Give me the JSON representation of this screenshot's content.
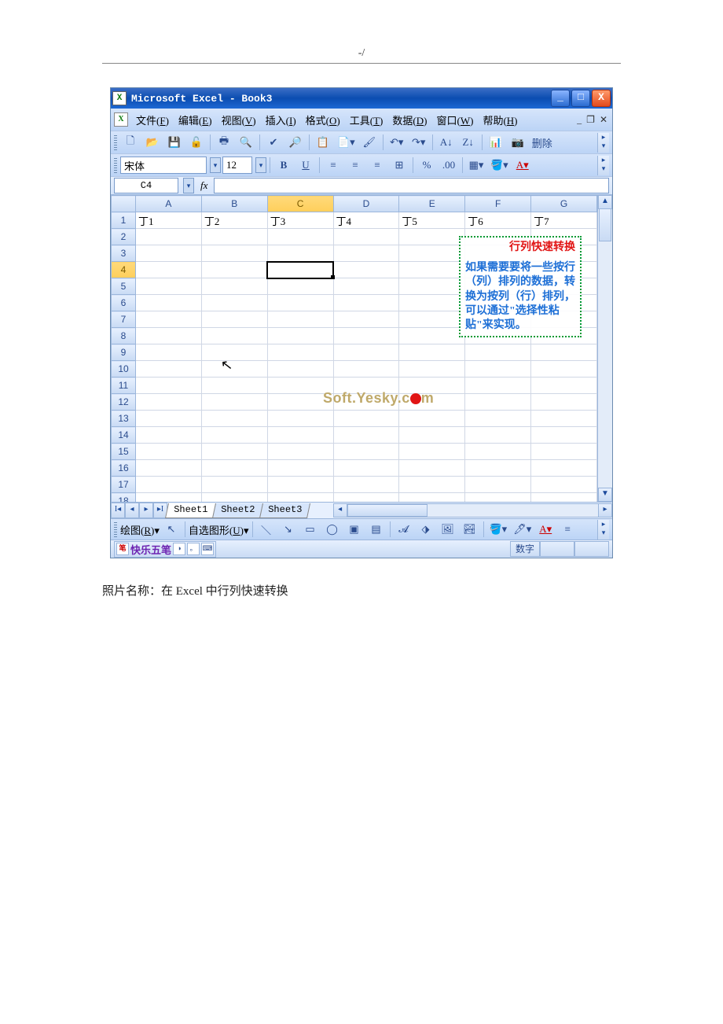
{
  "page": {
    "header_mark": "-/"
  },
  "title": {
    "text": "Microsoft Excel - Book3"
  },
  "menu": {
    "items": [
      {
        "label": "文件",
        "key": "F"
      },
      {
        "label": "编辑",
        "key": "E"
      },
      {
        "label": "视图",
        "key": "V"
      },
      {
        "label": "插入",
        "key": "I"
      },
      {
        "label": "格式",
        "key": "O"
      },
      {
        "label": "工具",
        "key": "T"
      },
      {
        "label": "数据",
        "key": "D"
      },
      {
        "label": "窗口",
        "key": "W"
      },
      {
        "label": "帮助",
        "key": "H"
      }
    ]
  },
  "font": {
    "name": "宋体",
    "size": "12"
  },
  "toolbar": {
    "delete_label": "删除"
  },
  "formula": {
    "cell_ref": "C4",
    "fx_label": "fx"
  },
  "columns": [
    "A",
    "B",
    "C",
    "D",
    "E",
    "F",
    "G"
  ],
  "rows": [
    1,
    2,
    3,
    4,
    5,
    6,
    7,
    8,
    9,
    10,
    11,
    12,
    13,
    14,
    15,
    16,
    17,
    18
  ],
  "row1": [
    "丁1",
    "丁2",
    "丁3",
    "丁4",
    "丁5",
    "丁6",
    "丁7"
  ],
  "selected": {
    "row": 4,
    "col": "C"
  },
  "callout": {
    "title": "行列快速转换",
    "body": "如果需要要将一些按行（列）排列的数据，转换为按列（行）排列，可以通过\"选择性粘贴\"来实现。"
  },
  "watermark": {
    "text1": "Soft.Yesky.c",
    "text2": "m"
  },
  "tabs": [
    "Sheet1",
    "Sheet2",
    "Sheet3"
  ],
  "draw": {
    "label1": "绘图",
    "key1": "R",
    "label2": "自选图形",
    "key2": "U"
  },
  "status": {
    "ime_name": "快乐五笔",
    "indicator": "数字"
  },
  "caption": "照片名称：在 Excel 中行列快速转换"
}
